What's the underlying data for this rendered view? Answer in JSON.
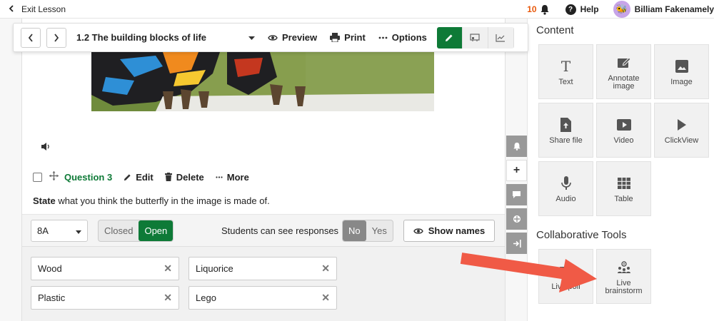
{
  "topbar": {
    "exit_label": "Exit Lesson",
    "notification_count": "10",
    "help_label": "Help",
    "user_name": "Billiam Fakenamely"
  },
  "toolbar": {
    "lesson_title": "1.2 The building blocks of life",
    "preview_label": "Preview",
    "print_label": "Print",
    "options_label": "Options"
  },
  "question": {
    "title": "Question 3",
    "edit_label": "Edit",
    "delete_label": "Delete",
    "more_label": "More",
    "prompt_bold": "State",
    "prompt_rest": " what you think the butterfly in the image is made of."
  },
  "responses": {
    "class_value": "8A",
    "closed_label": "Closed",
    "open_label": "Open",
    "students_see_label": "Students can see responses",
    "no_label": "No",
    "yes_label": "Yes",
    "show_names_label": "Show names",
    "answers": [
      "Wood",
      "Liquorice",
      "Plastic",
      "Lego"
    ]
  },
  "panel": {
    "content_heading": "Content",
    "content_tiles": [
      {
        "label": "Text",
        "icon": "text-icon"
      },
      {
        "label": "Annotate image",
        "icon": "annotate-icon"
      },
      {
        "label": "Image",
        "icon": "image-icon"
      },
      {
        "label": "Share file",
        "icon": "share-file-icon"
      },
      {
        "label": "Video",
        "icon": "video-icon"
      },
      {
        "label": "ClickView",
        "icon": "play-icon"
      },
      {
        "label": "Audio",
        "icon": "microphone-icon"
      },
      {
        "label": "Table",
        "icon": "table-icon"
      }
    ],
    "collab_heading": "Collaborative Tools",
    "collab_tiles": [
      {
        "label": "Live poll",
        "icon": "poll-icon"
      },
      {
        "label": "Live brainstorm",
        "icon": "brainstorm-icon"
      }
    ]
  },
  "colors": {
    "accent_green": "#0e7a37",
    "notification_orange": "#e8590c",
    "arrow_red": "#f05a46"
  }
}
